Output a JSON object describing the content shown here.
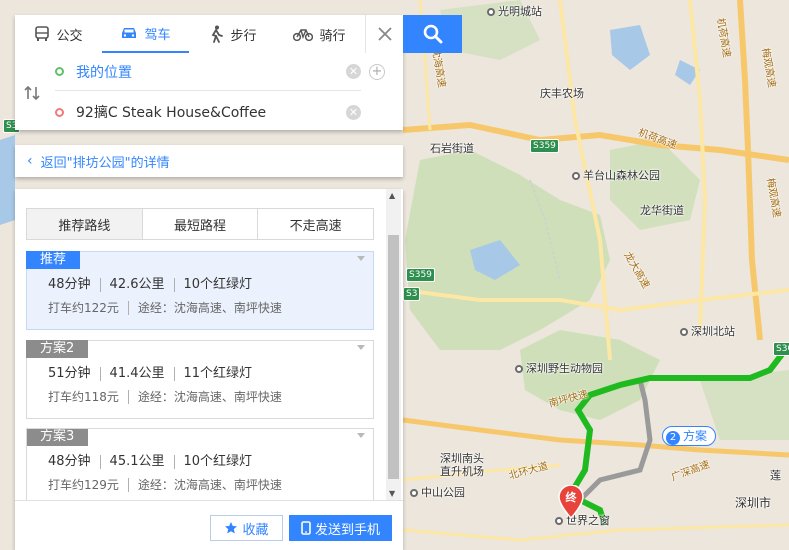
{
  "colors": {
    "accent": "#3385ff",
    "start_dot": "#5fc36a",
    "end_dot": "#f07b7b",
    "route_green": "#1fba1f",
    "route_gray": "#9a9a9a",
    "marker_red": "#e8443b"
  },
  "search": {
    "modes": [
      {
        "label": "公交",
        "icon": "bus-icon"
      },
      {
        "label": "驾车",
        "icon": "car-icon"
      },
      {
        "label": "步行",
        "icon": "walk-icon"
      },
      {
        "label": "骑行",
        "icon": "bike-icon"
      }
    ],
    "active_mode": "驾车",
    "start_value": "我的位置",
    "end_value": "92摛C Steak House&Coffee"
  },
  "back_link": "返回\"排坊公园\"的详情",
  "strategy_tabs": [
    "推荐路线",
    "最短路程",
    "不走高速"
  ],
  "plans": [
    {
      "badge": "推荐",
      "badge_color": "#3385ff",
      "time": "48分钟",
      "distance": "42.6公里",
      "lights": "10个红绿灯",
      "taxi": "打车约122元",
      "via": "途经：沈海高速、南坪快速"
    },
    {
      "badge": "方案2",
      "badge_color": "#8c8c8c",
      "time": "51分钟",
      "distance": "41.4公里",
      "lights": "11个红绿灯",
      "taxi": "打车约118元",
      "via": "途经：沈海高速、南坪快速"
    },
    {
      "badge": "方案3",
      "badge_color": "#8c8c8c",
      "time": "48分钟",
      "distance": "45.1公里",
      "lights": "10个红绿灯",
      "taxi": "打车约129元",
      "via": "途经：沈海高速、南坪快速"
    }
  ],
  "actions": {
    "favorite": "收藏",
    "send": "发送到手机"
  },
  "map": {
    "labels": [
      "光明城站",
      "庆丰农场",
      "石岩街道",
      "羊台山森林公园",
      "龙华街道",
      "深圳北站",
      "深圳野生动物园",
      "深圳南头直升机场",
      "中山公园",
      "世界之窗",
      "深圳市",
      "莲"
    ],
    "road_labels": [
      "机荷高速",
      "机荷高速",
      "梅观高速",
      "梅观高速",
      "南坪快速",
      "北环大道",
      "龙大高速",
      "广深高速",
      "沈海高速"
    ],
    "shields": [
      "S359",
      "S359",
      "S3",
      "S30",
      "S3"
    ],
    "end_marker": "终",
    "plan_tag": {
      "num": "2",
      "label": "方案"
    }
  }
}
